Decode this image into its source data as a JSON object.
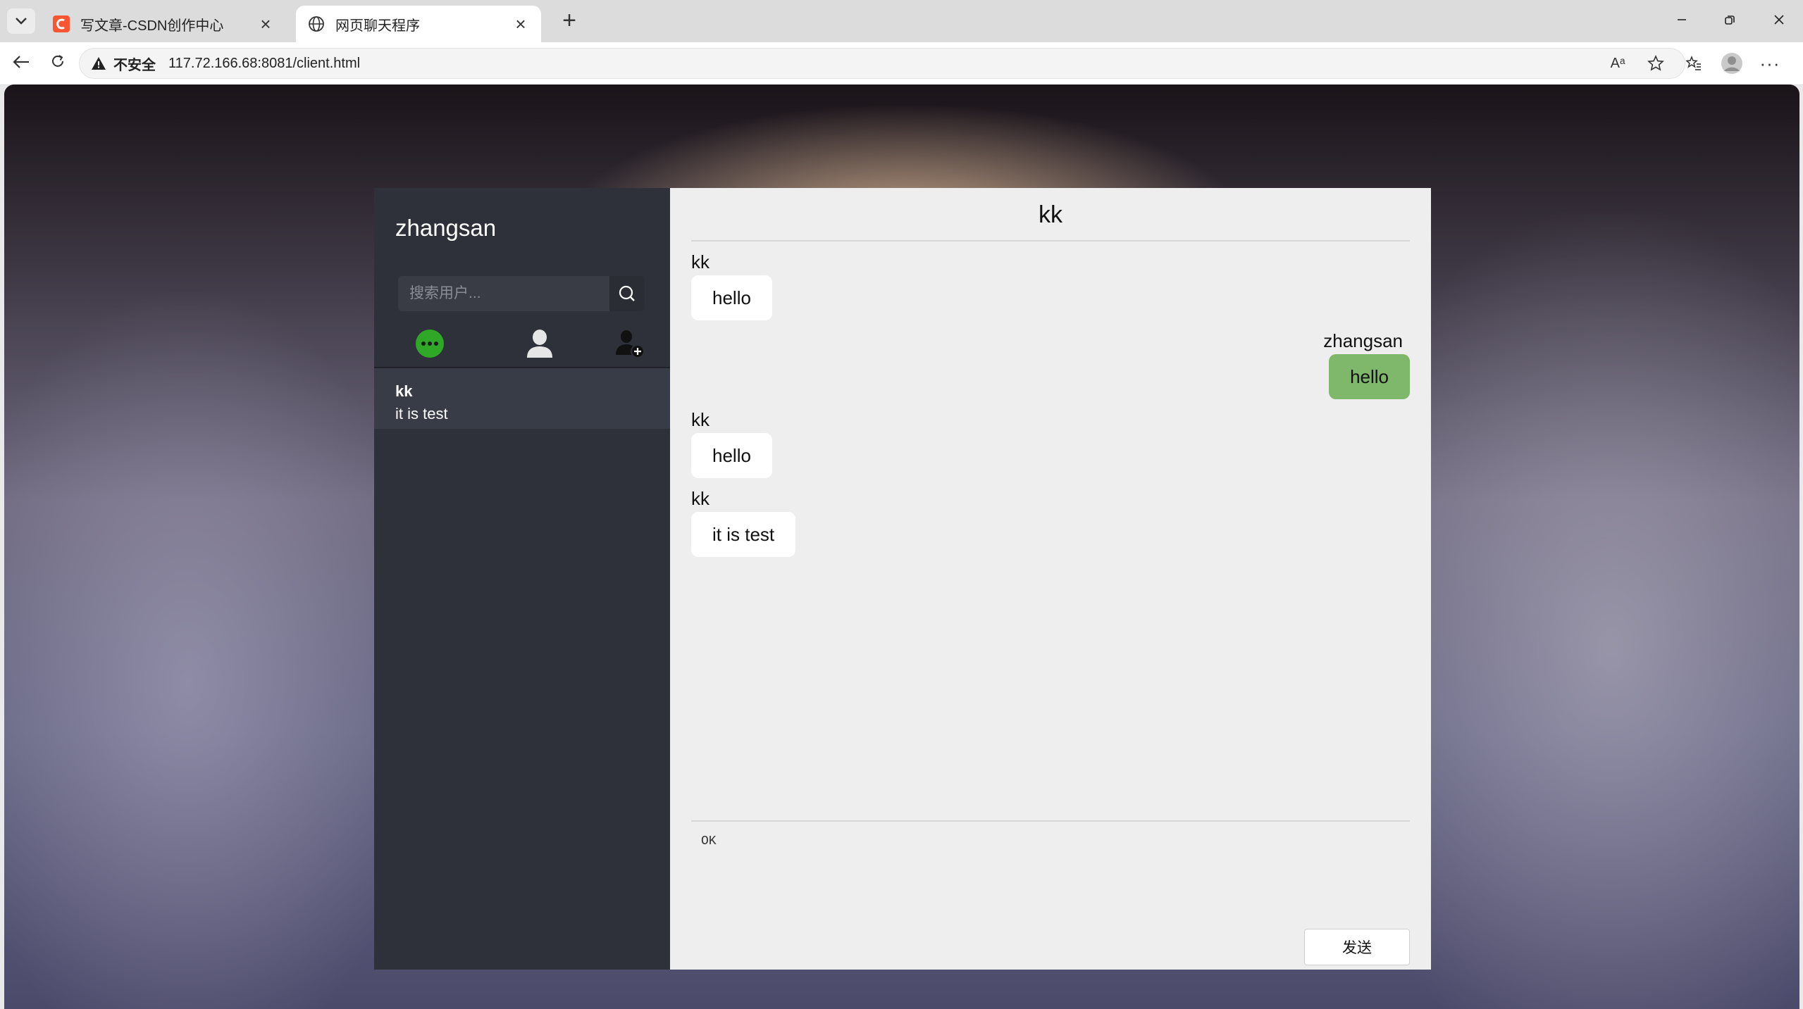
{
  "browser": {
    "tabs": [
      {
        "title": "写文章-CSDN创作中心",
        "active": false,
        "favicon": "csdn-c-icon",
        "favicon_color": "#fc5531"
      },
      {
        "title": "网页聊天程序",
        "active": true,
        "favicon": "globe-icon"
      }
    ],
    "security_label": "不安全",
    "url": "117.72.166.68:8081/client.html"
  },
  "app": {
    "username": "zhangsan",
    "search": {
      "placeholder": "搜索用户..."
    },
    "nav_tabs": [
      {
        "name": "chat-tab",
        "icon": "chat-bubble-icon",
        "color": "#2fa827"
      },
      {
        "name": "contacts-tab",
        "icon": "user-icon",
        "color": "#e6e6e6"
      },
      {
        "name": "add-friend-tab",
        "icon": "add-user-icon",
        "color": "#111111"
      }
    ],
    "sessions": [
      {
        "name": "kk",
        "last_message": "it is test"
      }
    ],
    "chat": {
      "title": "kk",
      "messages": [
        {
          "sender": "kk",
          "text": "hello",
          "mine": false
        },
        {
          "sender": "zhangsan",
          "text": "hello",
          "mine": true
        },
        {
          "sender": "kk",
          "text": "hello",
          "mine": false
        },
        {
          "sender": "kk",
          "text": "it is test",
          "mine": false
        }
      ],
      "input_value": "OK",
      "send_label": "发送"
    }
  },
  "colors": {
    "sidebar_bg": "#2e3139",
    "main_bg": "#eeeeee",
    "own_bubble": "#7fb76b",
    "other_bubble": "#ffffff"
  }
}
